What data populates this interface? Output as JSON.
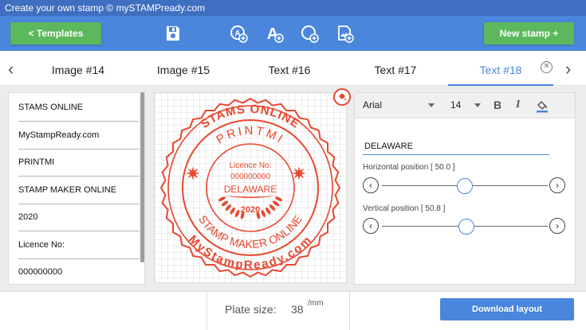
{
  "window": {
    "title": "Create your own stamp © mySTAMPready.com"
  },
  "toolbar": {
    "templates_label": "<  Templates",
    "new_stamp_label": "New stamp +",
    "icons": [
      "save-icon",
      "add-circle-text-icon",
      "add-text-icon",
      "add-circle-icon",
      "add-image-icon"
    ]
  },
  "tabs": [
    {
      "label": "Image #14",
      "active": false
    },
    {
      "label": "Image #15",
      "active": false
    },
    {
      "label": "Text #16",
      "active": false
    },
    {
      "label": "Text #17",
      "active": false
    },
    {
      "label": "Text #18",
      "active": true
    }
  ],
  "list": {
    "items": [
      "STAMS ONLINE",
      "MyStampReady.com",
      "PRINTMI",
      "STAMP MAKER ONLINE",
      "2020",
      "Licence No:",
      "000000000"
    ]
  },
  "stamp": {
    "color": "#e9472f",
    "outer_top_text": "STAMS ONLINE",
    "outer_bottom_text": "MyStampReady.com",
    "inner_top_text": "PRINTMI",
    "inner_bottom_text": "STAMP MAKER ONLINE",
    "licence_label": "Licence No:",
    "licence_number": "000000000",
    "center_text": "DELAWARE",
    "year": "2020"
  },
  "properties": {
    "font": "Arial",
    "size": "14",
    "bold_label": "B",
    "italic_label": "I",
    "text_value": "DELAWARE",
    "horizontal_label": "Horizontal position [ 50.0 ]",
    "horizontal_value": 50.0,
    "vertical_label": "Vertical position [ 50.8 ]",
    "vertical_value": 50.8,
    "accent": "#4a86dc"
  },
  "footer": {
    "plate_label": "Plate size:",
    "plate_value": "38",
    "plate_unit": "/mm",
    "download_label": "Download layout"
  }
}
